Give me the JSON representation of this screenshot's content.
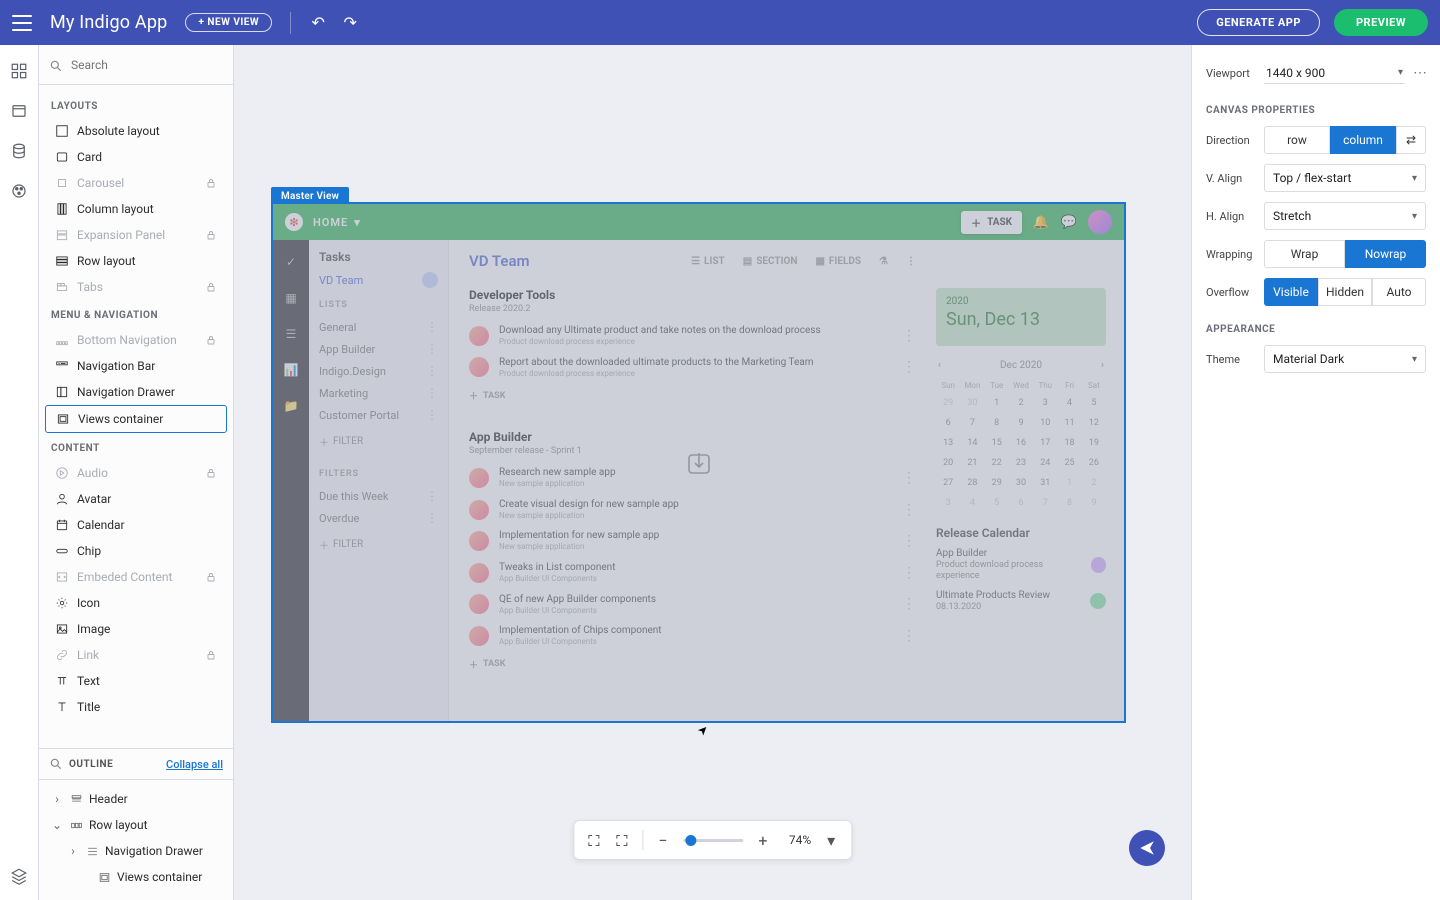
{
  "topbar": {
    "app_title": "My Indigo App",
    "new_view": "+ NEW VIEW",
    "generate": "GENERATE APP",
    "preview": "PREVIEW"
  },
  "left": {
    "search_placeholder": "Search",
    "section_layouts": "LAYOUTS",
    "section_menu": "MENU & NAVIGATION",
    "section_content": "CONTENT",
    "layouts": [
      {
        "label": "Absolute layout",
        "disabled": false,
        "locked": false
      },
      {
        "label": "Card",
        "disabled": false,
        "locked": false
      },
      {
        "label": "Carousel",
        "disabled": true,
        "locked": true
      },
      {
        "label": "Column layout",
        "disabled": false,
        "locked": false
      },
      {
        "label": "Expansion Panel",
        "disabled": true,
        "locked": true
      },
      {
        "label": "Row layout",
        "disabled": false,
        "locked": false
      },
      {
        "label": "Tabs",
        "disabled": true,
        "locked": true
      }
    ],
    "menu_nav": [
      {
        "label": "Bottom Navigation",
        "disabled": true,
        "locked": true
      },
      {
        "label": "Navigation Bar",
        "disabled": false,
        "locked": false
      },
      {
        "label": "Navigation Drawer",
        "disabled": false,
        "locked": false
      },
      {
        "label": "Views container",
        "disabled": false,
        "locked": false,
        "selected": true
      }
    ],
    "content": [
      {
        "label": "Audio",
        "disabled": true,
        "locked": true
      },
      {
        "label": "Avatar",
        "disabled": false,
        "locked": false
      },
      {
        "label": "Calendar",
        "disabled": false,
        "locked": false
      },
      {
        "label": "Chip",
        "disabled": false,
        "locked": false
      },
      {
        "label": "Embeded Content",
        "disabled": true,
        "locked": true
      },
      {
        "label": "Icon",
        "disabled": false,
        "locked": false
      },
      {
        "label": "Image",
        "disabled": false,
        "locked": false
      },
      {
        "label": "Link",
        "disabled": true,
        "locked": true
      },
      {
        "label": "Text",
        "disabled": false,
        "locked": false
      },
      {
        "label": "Title",
        "disabled": false,
        "locked": false
      }
    ],
    "outline_title": "OUTLINE",
    "collapse": "Collapse all",
    "outline": {
      "header": "Header",
      "row_layout": "Row layout",
      "nav_drawer": "Navigation Drawer",
      "views_container": "Views container"
    }
  },
  "right": {
    "viewport_lbl": "Viewport",
    "viewport_val": "1440 x 900",
    "section_canvas": "CANVAS PROPERTIES",
    "direction_lbl": "Direction",
    "direction": {
      "row": "row",
      "column": "column"
    },
    "valign_lbl": "V. Align",
    "valign_val": "Top / flex-start",
    "halign_lbl": "H. Align",
    "halign_val": "Stretch",
    "wrap_lbl": "Wrapping",
    "wrap": {
      "wrap": "Wrap",
      "nowrap": "Nowrap"
    },
    "overflow_lbl": "Overflow",
    "overflow": {
      "visible": "Visible",
      "hidden": "Hidden",
      "auto": "Auto"
    },
    "section_appearance": "APPEARANCE",
    "theme_lbl": "Theme",
    "theme_val": "Material Dark"
  },
  "canvas": {
    "master_tag": "Master View",
    "header": {
      "home": "HOME",
      "task_btn": "TASK"
    },
    "sidebar": {
      "tasks": "Tasks",
      "team": "VD Team",
      "lists_sec": "LISTS",
      "lists": [
        "General",
        "App Builder",
        "Indigo.Design",
        "Marketing",
        "Customer Portal"
      ],
      "add_filter": "FILTER",
      "filters_sec": "FILTERS",
      "filters": [
        "Due this Week",
        "Overdue"
      ]
    },
    "main": {
      "title": "VD Team",
      "viewbar": {
        "list": "LIST",
        "section": "SECTION",
        "fields": "FIELDS"
      },
      "g1_title": "Developer Tools",
      "g1_sub": "Release 2020.2",
      "g1_tasks": [
        {
          "t": "Download any Ultimate product and take notes on the download process",
          "s": "Product download process experience"
        },
        {
          "t": "Report about the downloaded ultimate products to the Marketing Team",
          "s": "Product download process experience"
        }
      ],
      "g2_title": "App Builder",
      "g2_sub": "September release - Sprint 1",
      "g2_tasks": [
        {
          "t": "Research new sample app",
          "s": "New sample application"
        },
        {
          "t": "Create visual design for new sample app",
          "s": "New sample application"
        },
        {
          "t": "Implementation for new sample app",
          "s": "New sample application"
        },
        {
          "t": "Tweaks in List component",
          "s": "App Builder UI Components"
        },
        {
          "t": "QE of new App Builder components",
          "s": "App Builder UI Components"
        },
        {
          "t": "Implementation of Chips component",
          "s": "App Builder UI Components"
        }
      ],
      "add_task": "TASK"
    },
    "side": {
      "year": "2020",
      "date": "Sun, Dec 13",
      "cal_header": "Dec 2020",
      "dow": [
        "Sun",
        "Mon",
        "Tue",
        "Wed",
        "Thu",
        "Fri",
        "Sat"
      ],
      "days": [
        {
          "v": "29",
          "dim": true
        },
        {
          "v": "30",
          "dim": true
        },
        {
          "v": "1"
        },
        {
          "v": "2"
        },
        {
          "v": "3"
        },
        {
          "v": "4"
        },
        {
          "v": "5"
        },
        {
          "v": "6"
        },
        {
          "v": "7"
        },
        {
          "v": "8"
        },
        {
          "v": "9"
        },
        {
          "v": "10"
        },
        {
          "v": "11"
        },
        {
          "v": "12"
        },
        {
          "v": "13"
        },
        {
          "v": "14"
        },
        {
          "v": "15"
        },
        {
          "v": "16"
        },
        {
          "v": "17"
        },
        {
          "v": "18"
        },
        {
          "v": "19"
        },
        {
          "v": "20"
        },
        {
          "v": "21"
        },
        {
          "v": "22"
        },
        {
          "v": "23"
        },
        {
          "v": "24"
        },
        {
          "v": "25"
        },
        {
          "v": "26"
        },
        {
          "v": "27"
        },
        {
          "v": "28"
        },
        {
          "v": "29"
        },
        {
          "v": "30"
        },
        {
          "v": "31"
        },
        {
          "v": "1",
          "dim": true
        },
        {
          "v": "2",
          "dim": true
        },
        {
          "v": "3",
          "dim": true
        },
        {
          "v": "4",
          "dim": true
        },
        {
          "v": "5",
          "dim": true
        },
        {
          "v": "6",
          "dim": true
        },
        {
          "v": "7",
          "dim": true
        },
        {
          "v": "8",
          "dim": true
        },
        {
          "v": "9",
          "dim": true
        }
      ],
      "rc_title": "Release Calendar",
      "rc_items": [
        {
          "t": "App Builder",
          "s": "Product download process experience",
          "c": "#cfa9ff"
        },
        {
          "t": "Ultimate Products Review",
          "s": "08.13.2020",
          "c": "#7ee0a4"
        }
      ]
    }
  },
  "zoombar": {
    "value": "74%"
  }
}
